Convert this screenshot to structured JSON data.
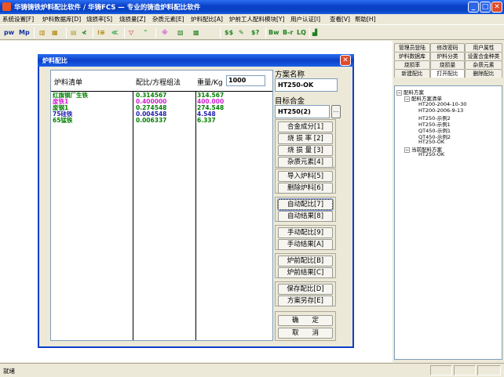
{
  "window": {
    "title": "华铸铸铁炉料配比软件 / 华铸FCS — 专业的铸造炉料配比软件"
  },
  "menu": [
    "系统设置[F]",
    "炉料数据库[D]",
    "烧损率[S]",
    "烧损量[Z]",
    "杂质元素[E]",
    "炉料配比[A]",
    "炉前工人配料模块[Y]",
    "用户认证[I]",
    "查看[V]",
    "帮助[H]"
  ],
  "toolbar": {
    "items": [
      "pw",
      "Mp",
      "Bw",
      "B-r",
      "LQ",
      "$$",
      "$?"
    ]
  },
  "side_tabs": {
    "row1": [
      "管理员登陆",
      "修改密码",
      "用户属性"
    ],
    "row2": [
      "炉料数据库",
      "炉料分类",
      "设置合金种类"
    ],
    "row3": [
      "烧损率",
      "烧损量",
      "杂质元素"
    ],
    "row4": [
      "新建配比",
      "打开配比",
      "删除配比"
    ]
  },
  "tree": {
    "root": "配料方案",
    "list_label": "配料方案清单",
    "items": [
      "HT200-2004-10-30",
      "HT200-2006-9-13",
      "HT250-示例2",
      "HT250-示例1",
      "QT450-示例1",
      "QT450-示例2",
      "HT250-OK"
    ],
    "current_label": "当前配料方案",
    "current_item": "HT250-OK"
  },
  "status": {
    "text": "就绪"
  },
  "dialog": {
    "title": "炉料配比",
    "header_material": "炉料清单",
    "header_ratio": "配比/方程组法",
    "header_weight": "重量/Kg",
    "weight_value": "1000",
    "rows": [
      {
        "name": "红旗钢厂生铁",
        "ratio": "0.314567",
        "weight": "314.567",
        "color": "#008000"
      },
      {
        "name": "废铁1",
        "ratio": "0.400000",
        "weight": "400.000",
        "color": "#d020d0"
      },
      {
        "name": "废钢1",
        "ratio": "0.274548",
        "weight": "274.548",
        "color": "#008000"
      },
      {
        "name": "75硅铁",
        "ratio": "0.004548",
        "weight": "4.548",
        "color": "#2020b0"
      },
      {
        "name": "65锰铁",
        "ratio": "0.006337",
        "weight": "6.337",
        "color": "#008000"
      }
    ],
    "scheme_label": "方案名称",
    "scheme_value": "HT250-OK",
    "alloy_label": "目标合金",
    "alloy_value": "HT250(2)",
    "ellipsis": "...",
    "buttons": {
      "composition": "合金成分[1]",
      "burn_rate": "烧 损 率 [2]",
      "burn_amount": "烧 损 量 [3]",
      "impurity": "杂质元素[4]",
      "import": "导入炉料[5]",
      "delete": "删除炉料[6]",
      "auto": "自动配比[7]",
      "auto_result": "自动结果[8]",
      "manual": "手动配比[9]",
      "manual_result": "手动结果[A]",
      "pre_furnace": "炉前配比[B]",
      "pre_result": "炉前结果[C]",
      "save": "保存配比[D]",
      "save_as": "方案另存[E]",
      "ok": "确　　定",
      "cancel": "取　　消"
    }
  }
}
